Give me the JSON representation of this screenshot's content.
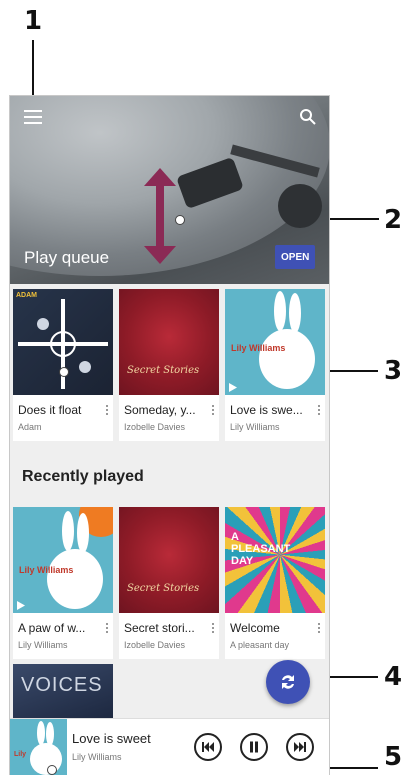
{
  "callouts": [
    "1",
    "2",
    "3",
    "4",
    "5"
  ],
  "hero": {
    "title": "Play queue",
    "open_label": "OPEN"
  },
  "queue": [
    {
      "title": "Does it float",
      "artist": "Adam",
      "art_text": "ADAM"
    },
    {
      "title": "Someday, y...",
      "artist": "Izobelle Davies",
      "art_text": "Secret Stories"
    },
    {
      "title": "Love is swe...",
      "artist": "Lily Williams",
      "art_text": "Lily Williams"
    }
  ],
  "recent": {
    "title": "Recently played",
    "items": [
      {
        "title": "A paw of w...",
        "artist": "Lily Williams",
        "art_text": "Lily Williams"
      },
      {
        "title": "Secret stori...",
        "artist": "Izobelle Davies",
        "art_text": "Secret Stories"
      },
      {
        "title": "Welcome",
        "artist": "A pleasant day",
        "art_text": "A PLEASANT DAY"
      }
    ],
    "extra_art_text": "VOICES"
  },
  "mini_player": {
    "title": "Love is sweet",
    "artist": "Lily Williams",
    "art_text": "Lily"
  },
  "colors": {
    "accent": "#3f51b5"
  },
  "icons": [
    "menu-icon",
    "search-icon",
    "shuffle-icon",
    "previous-icon",
    "pause-icon",
    "next-icon",
    "more-vert-icon",
    "play-small-icon",
    "double-arrow-icon"
  ]
}
